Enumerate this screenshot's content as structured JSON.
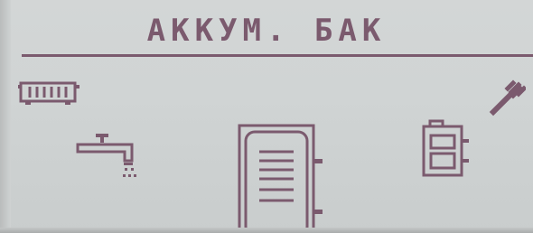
{
  "screen": {
    "title": "АККУМ. БАК"
  },
  "icons": {
    "radiator": "radiator-icon",
    "tap": "water-tap-icon",
    "wrench": "wrench-icon",
    "tank": "buffer-tank-icon",
    "boiler": "boiler-icon"
  },
  "colors": {
    "lcd_background": "#d0d4d4",
    "lcd_foreground": "#7b5a6e"
  }
}
